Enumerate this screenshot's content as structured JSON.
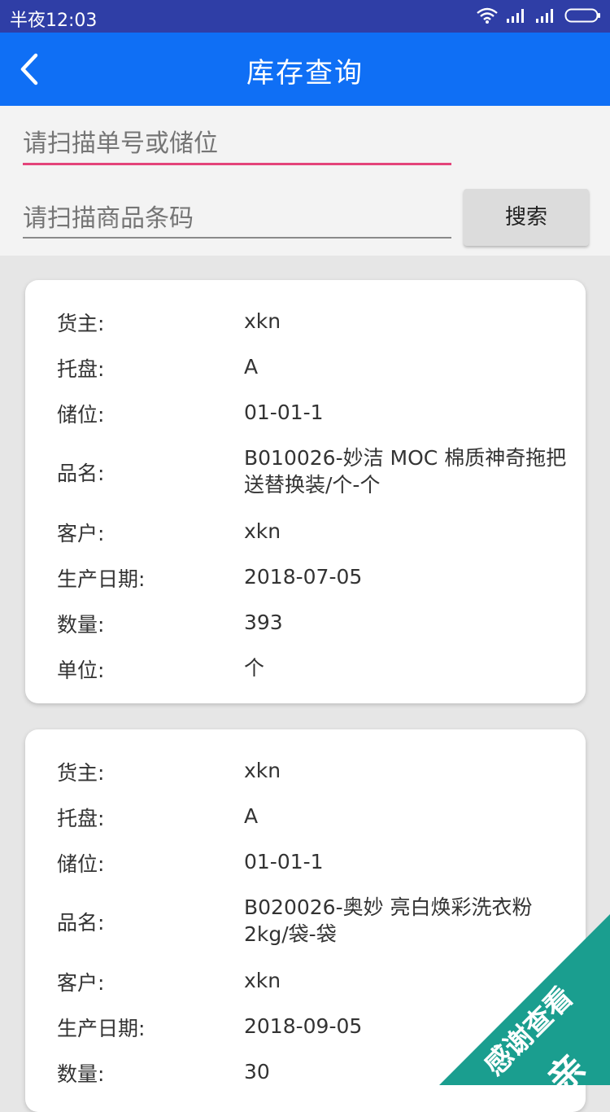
{
  "status": {
    "time": "半夜12:03"
  },
  "header": {
    "title": "库存查询"
  },
  "search": {
    "order_placeholder": "请扫描单号或储位",
    "barcode_placeholder": "请扫描商品条码",
    "button_label": "搜索"
  },
  "labels": {
    "owner": "货主:",
    "pallet": "托盘:",
    "location": "储位:",
    "product": "品名:",
    "customer": "客户:",
    "production_date": "生产日期:",
    "quantity": "数量:",
    "unit": "单位:"
  },
  "records": [
    {
      "owner": "xkn",
      "pallet": "A",
      "location": "01-01-1",
      "product": "B010026-妙洁 MOC 棉质神奇拖把送替换装/个-个",
      "customer": "xkn",
      "production_date": "2018-07-05",
      "quantity": "393",
      "unit": "个"
    },
    {
      "owner": "xkn",
      "pallet": "A",
      "location": "01-01-1",
      "product": "B020026-奥妙 亮白焕彩洗衣粉2kg/袋-袋",
      "customer": "xkn",
      "production_date": "2018-09-05",
      "quantity": "30"
    }
  ],
  "watermark": {
    "line1": "感谢查看",
    "line2": "亲"
  },
  "colors": {
    "appbar": "#0f6ff5",
    "statusbar": "#2f3ea6",
    "focus_underline": "#e4447a",
    "watermark": "#1a9e8f"
  }
}
